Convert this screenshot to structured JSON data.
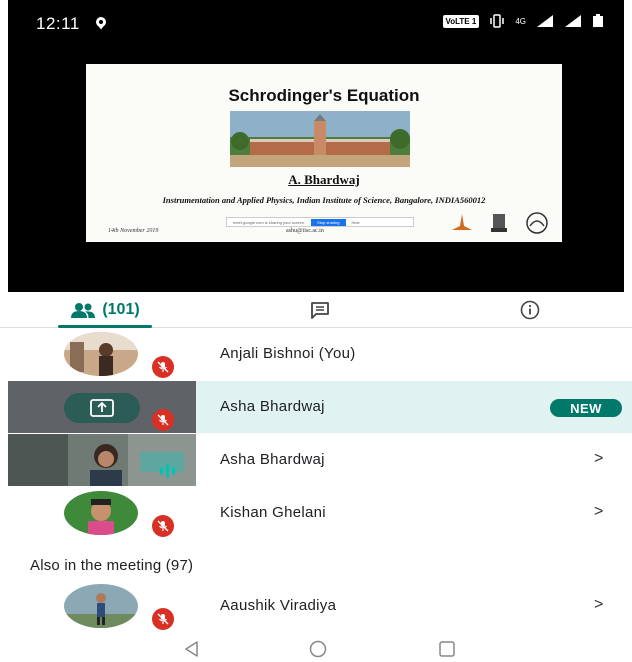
{
  "status": {
    "time": "12:11",
    "volte": "VoLTE 1",
    "network": "4G"
  },
  "slide": {
    "title": "Schrodinger's Equation",
    "author": "A. Bhardwaj",
    "institution": "Instrumentation and Applied Physics, Indian Institute of Science, Bangalore, INDIA560012",
    "date": "14th November 2019",
    "email": "ashu@iisc.ac.in",
    "share_bar": {
      "text": "meet.google.com is sharing your screen.",
      "stop": "Stop sharing",
      "hide": "Hide"
    }
  },
  "tabs": {
    "people_count": "(101)"
  },
  "participants": [
    {
      "name": "Anjali Bishnoi (You)"
    },
    {
      "name": "Asha Bhardwaj",
      "badge": "NEW"
    },
    {
      "name": "Asha Bhardwaj",
      "chevron": ">"
    },
    {
      "name": "Kishan Ghelani",
      "chevron": ">"
    }
  ],
  "also_in_meeting": {
    "label": "Also in the meeting (97)",
    "participants": [
      {
        "name": "Aaushik Viradiya",
        "chevron": ">"
      }
    ]
  },
  "colors": {
    "accent": "#00796b",
    "mute": "#d93025",
    "highlight_row": "#e0f3f1"
  }
}
